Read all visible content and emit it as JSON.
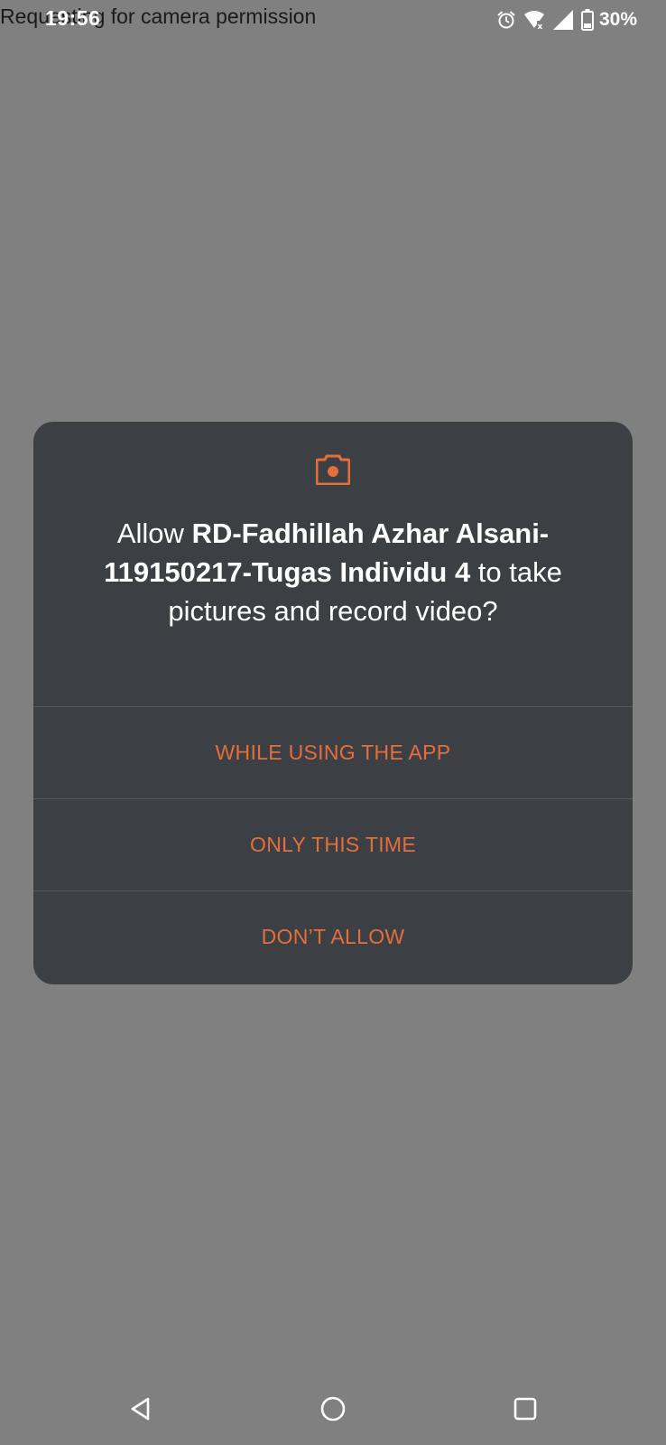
{
  "background_text": "Requesting for camera permission",
  "status_bar": {
    "time": "19:56",
    "battery_percent": "30%",
    "icons": [
      "alarm-icon",
      "wifi-icon",
      "cellular-signal-icon",
      "battery-icon"
    ]
  },
  "dialog": {
    "icon": "camera-icon",
    "message_prefix": "Allow ",
    "app_name": "RD-Fadhillah Azhar Alsani-119150217-Tugas Individu 4",
    "message_suffix": " to take pictures and record video?",
    "actions": [
      {
        "label": "WHILE USING THE APP"
      },
      {
        "label": "ONLY THIS TIME"
      },
      {
        "label": "DON’T ALLOW"
      }
    ]
  },
  "nav_bar": {
    "icons": [
      "back-icon",
      "home-icon",
      "recents-icon"
    ]
  },
  "colors": {
    "scrim": "#808080",
    "dialog_bg": "#3c3f43",
    "accent": "#e46e3c",
    "divider": "#55595e"
  }
}
